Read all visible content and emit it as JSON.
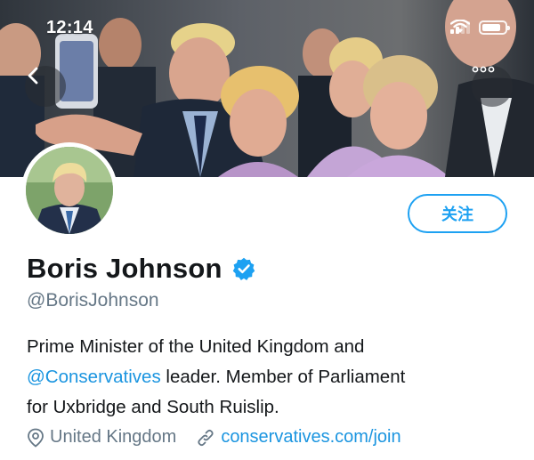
{
  "status_bar": {
    "time": "12:14",
    "signal_bars_active": 2,
    "battery_level": 0.85
  },
  "header": {
    "back_icon": "chevron-left-icon",
    "more_icon": "more-dots-icon"
  },
  "profile": {
    "follow_label": "关注",
    "display_name": "Boris Johnson",
    "verified": true,
    "handle": "@BorisJohnson",
    "bio": {
      "line1": "Prime Minister of the United Kingdom and",
      "mention": "@Conservatives",
      "line2_rest": " leader. Member of Parliament",
      "line3": "for Uxbridge and South Ruislip."
    },
    "location": "United Kingdom",
    "website": "conservatives.com/join"
  },
  "colors": {
    "accent": "#1da1f2",
    "link": "#1b95e0",
    "secondary_text": "#657786",
    "primary_text": "#14171a"
  }
}
